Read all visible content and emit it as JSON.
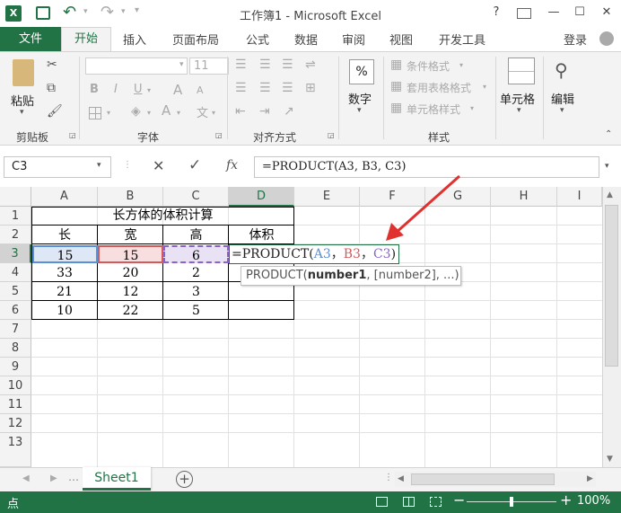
{
  "window": {
    "title": "工作簿1 - Microsoft Excel",
    "help": "?",
    "min": "—",
    "max": "☐",
    "close": "✕"
  },
  "tabs": [
    "文件",
    "开始",
    "插入",
    "页面布局",
    "公式",
    "数据",
    "审阅",
    "视图",
    "开发工具"
  ],
  "login": "登录",
  "ribbon": {
    "paste": "粘贴",
    "clipboard": "剪贴板",
    "font_size": "11",
    "bold": "B",
    "italic": "I",
    "underline": "U",
    "font": "字体",
    "align": "对齐方式",
    "percent": "%",
    "number": "数字",
    "cond_format": "条件格式",
    "table_format": "套用表格格式",
    "cell_style": "单元格样式",
    "style": "样式",
    "cells": "单元格",
    "edit": "编辑",
    "font_a_big": "A",
    "font_a_small": "A",
    "wen": "文"
  },
  "formula_bar": {
    "name_box": "C3",
    "cancel": "✕",
    "enter": "✓",
    "fx": "fx",
    "formula": "=PRODUCT(A3, B3, C3)"
  },
  "columns": [
    "A",
    "B",
    "C",
    "D",
    "E",
    "F",
    "G",
    "H",
    "I"
  ],
  "rows": [
    "1",
    "2",
    "3",
    "4",
    "5",
    "6",
    "7",
    "8",
    "9",
    "10",
    "11",
    "12",
    "13"
  ],
  "sheet": {
    "title": "长方体的体积计算",
    "headers": [
      "长",
      "宽",
      "高",
      "体积"
    ],
    "data": [
      [
        "15",
        "15",
        "6"
      ],
      [
        "33",
        "20",
        "2"
      ],
      [
        "21",
        "12",
        "3"
      ],
      [
        "10",
        "22",
        "5"
      ]
    ],
    "formula_prefix": "=PRODUCT(",
    "ref_a": "A3",
    "ref_b": "B3",
    "ref_c": "C3",
    "comma": "，",
    "close_paren": ")",
    "tooltip_fn": "PRODUCT(",
    "tooltip_arg1": "number1",
    "tooltip_rest": ", [number2], ...)"
  },
  "tabs_bottom": {
    "sheet1": "Sheet1",
    "add": "+"
  },
  "status": {
    "mode": "点",
    "zoom": "100%"
  },
  "colors": {
    "excel_green": "#217346",
    "ref_blue": "#5b8fd6",
    "ref_red": "#d45a5a",
    "ref_purple": "#8a62c9",
    "arrow_red": "#e0312e"
  }
}
